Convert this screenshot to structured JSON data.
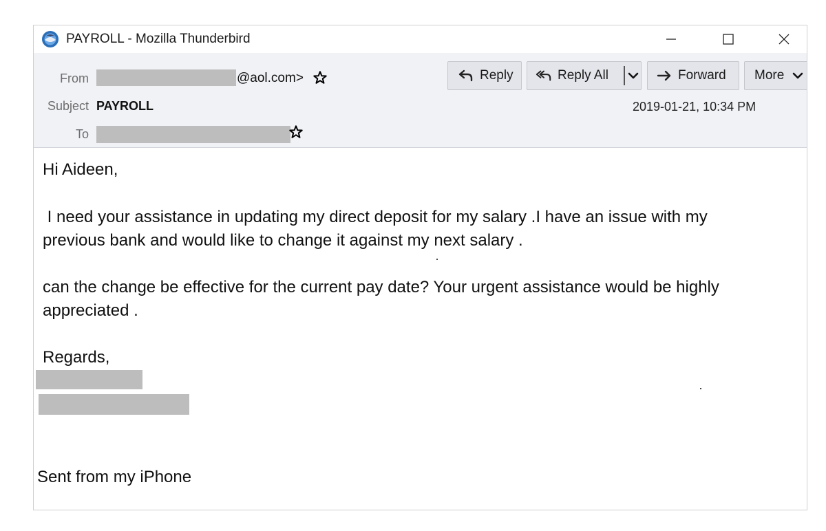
{
  "window": {
    "title": "PAYROLL - Mozilla Thunderbird",
    "app_icon": "thunderbird-icon",
    "controls": [
      "minimize-icon",
      "maximize-icon",
      "close-icon"
    ]
  },
  "header": {
    "from_label": "From",
    "from_value_suffix": "@aol.com>",
    "subject_label": "Subject",
    "subject_value": "PAYROLL",
    "to_label": "To",
    "date": "2019-01-21, 10:34 PM",
    "buttons": {
      "reply": "Reply",
      "reply_all": "Reply All",
      "forward": "Forward",
      "more": "More"
    }
  },
  "body": {
    "greeting": "Hi Aideen,",
    "para1_line1": " I need your assistance in updating my direct deposit for my salary .I have an issue with my",
    "para1_line2": "previous bank and would like to change it against my next salary .",
    "para2_line1": "can the change be effective for the current pay date? Your urgent assistance would be highly",
    "para2_line2": "appreciated .",
    "closing": "Regards,",
    "signature": "Sent from my iPhone"
  },
  "colors": {
    "header_bg": "#f1f2f6",
    "button_bg": "#e4e5ea",
    "redaction": "#bdbdbd",
    "label_gray": "#6e6e6e"
  }
}
